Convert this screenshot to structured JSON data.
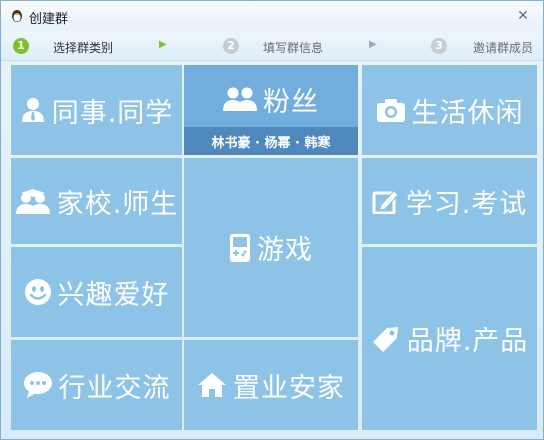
{
  "window": {
    "title": "创建群",
    "close_glyph": "✕"
  },
  "steps": [
    {
      "num": "1",
      "label": "选择群类别"
    },
    {
      "num": "2",
      "label": "填写群信息"
    },
    {
      "num": "3",
      "label": "邀请群成员"
    }
  ],
  "step_arrows": [
    "▶",
    "▶"
  ],
  "categories": {
    "colleagues": "同事.同学",
    "fans": "粉丝",
    "fans_subtitle": "林书豪 · 杨幂 · 韩寒",
    "leisure": "生活休闲",
    "school": "家校.师生",
    "games": "游戏",
    "study": "学习.考试",
    "hobby": "兴趣爱好",
    "brand": "品牌.产品",
    "industry": "行业交流",
    "realestate": "置业安家"
  },
  "icons": {
    "title": "qq-penguin-icon",
    "colleagues": "person-tie-icon",
    "fans": "two-people-icon",
    "leisure": "camera-icon",
    "school": "graduation-people-icon",
    "games": "gameboy-icon",
    "study": "pencil-edit-icon",
    "hobby": "smiley-icon",
    "brand": "price-tag-icon",
    "industry": "speech-bubble-icon",
    "realestate": "house-icon"
  },
  "colors": {
    "tile": "#8ec3e8",
    "selected_tile": "#72aedd",
    "banner": "#4f88bb",
    "active_step": "#7fc12b",
    "arrow_active": "#7fc12b",
    "arrow_inactive": "#9aaab8"
  }
}
